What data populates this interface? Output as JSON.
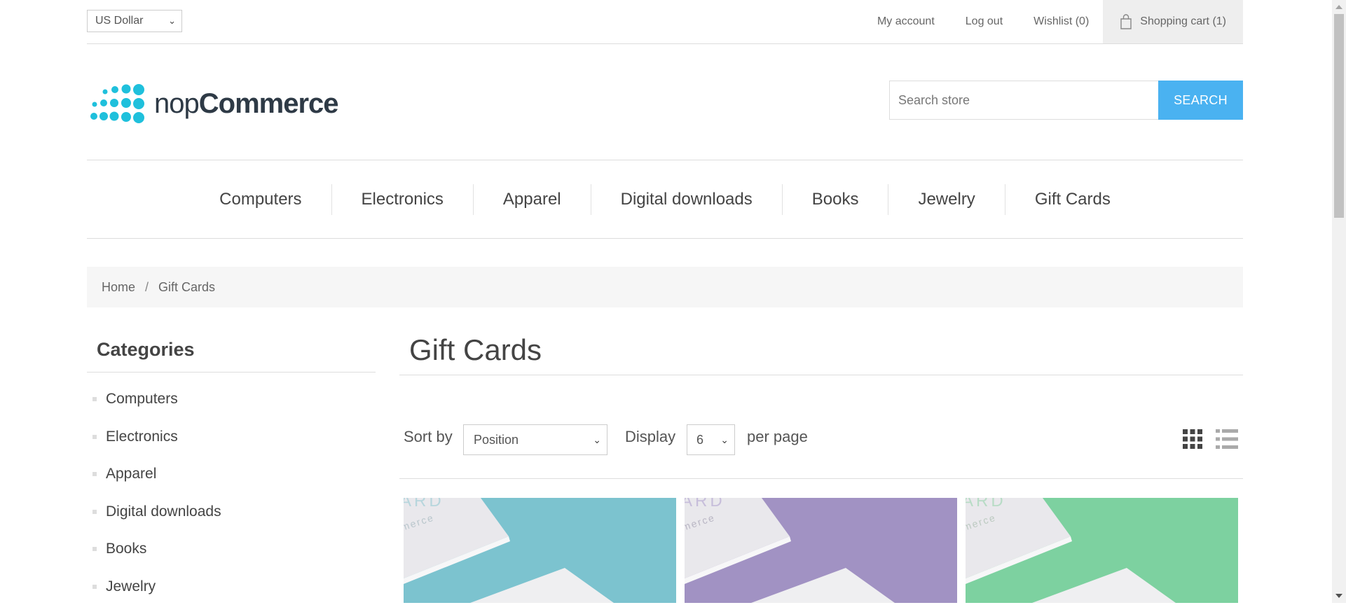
{
  "header": {
    "currency": "US Dollar",
    "links": [
      "My account",
      "Log out",
      "Wishlist (0)"
    ],
    "cart": "Shopping cart (1)"
  },
  "logo": {
    "text_light": "nop",
    "text_bold": "Commerce"
  },
  "search": {
    "placeholder": "Search store",
    "button": "SEARCH"
  },
  "menu": [
    "Computers",
    "Electronics",
    "Apparel",
    "Digital downloads",
    "Books",
    "Jewelry",
    "Gift Cards"
  ],
  "breadcrumb": {
    "home": "Home",
    "separator": "/",
    "current": "Gift Cards"
  },
  "sidebar": {
    "title": "Categories",
    "items": [
      "Computers",
      "Electronics",
      "Apparel",
      "Digital downloads",
      "Books",
      "Jewelry"
    ]
  },
  "main": {
    "title": "Gift Cards",
    "sort_label": "Sort by",
    "sort_value": "Position",
    "display_label": "Display",
    "display_value": "6",
    "per_page": "per page"
  },
  "products": [
    {
      "color": "#7cc3cf",
      "card_text": "ARD",
      "card_sub": "merce"
    },
    {
      "color": "#a192c3",
      "card_text": "ARD",
      "card_sub": "merce"
    },
    {
      "color": "#7dd1a0",
      "card_text": "ARD",
      "card_sub": "merce"
    }
  ],
  "colors": {
    "accent": "#4ab2f1",
    "logo": "#1fc0dc"
  }
}
